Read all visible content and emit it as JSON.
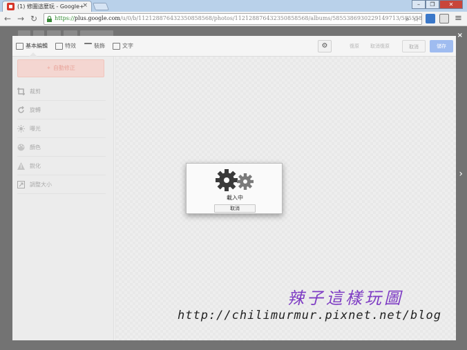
{
  "browser": {
    "tab_title": "(1) 修圖這麼玩 - Google+",
    "tab_close": "×",
    "window_buttons": {
      "minimize": "–",
      "restore": "❐",
      "close": "✕"
    },
    "url_scheme": "https://",
    "url_host": "plus.google.com",
    "url_path": "/u/0/b/112128876432350858568/photos/112128876432350858568/albums/5855386930229149713/585538693"
  },
  "page": {
    "close_label": "×",
    "next_label": "›"
  },
  "editor": {
    "tabs": [
      {
        "label": "基本編輯"
      },
      {
        "label": "特效"
      },
      {
        "label": "裝飾"
      },
      {
        "label": "文字"
      }
    ],
    "buttons": {
      "undo": "復原",
      "redo": "取消復原",
      "cancel": "取消",
      "done": "儲存"
    },
    "auto_fix": "自動修正",
    "tools": [
      {
        "label": "裁剪",
        "icon": "crop-icon"
      },
      {
        "label": "旋轉",
        "icon": "rotate-icon"
      },
      {
        "label": "曝光",
        "icon": "exposure-icon"
      },
      {
        "label": "顏色",
        "icon": "color-palette-icon"
      },
      {
        "label": "銳化",
        "icon": "sharpen-icon"
      },
      {
        "label": "調整大小",
        "icon": "resize-icon"
      }
    ]
  },
  "dialog": {
    "loading": "載入中",
    "cancel": "取消"
  },
  "watermark": {
    "title": "辣子這樣玩圖",
    "url": "http://chilimurmur.pixnet.net/blog"
  },
  "colors": {
    "auto_fix_bg": "#f4d6d1",
    "done_button": "#9fbcf0",
    "watermark_title": "#7e3cc4"
  }
}
